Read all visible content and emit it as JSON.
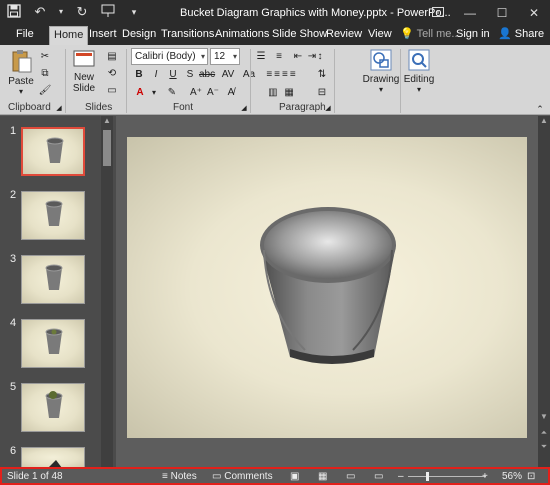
{
  "window": {
    "title": "Bucket Diagram Graphics with Money.pptx - PowerPo..."
  },
  "tabs": [
    {
      "label": "File"
    },
    {
      "label": "Home"
    },
    {
      "label": "Insert"
    },
    {
      "label": "Design"
    },
    {
      "label": "Transitions"
    },
    {
      "label": "Animations"
    },
    {
      "label": "Slide Show"
    },
    {
      "label": "Review"
    },
    {
      "label": "View"
    }
  ],
  "tell_me": "Tell me...",
  "sign_in": "Sign in",
  "share": "Share",
  "ribbon": {
    "paste_label": "Paste",
    "new_slide_label": "New Slide",
    "font_name": "Calibri (Body)",
    "font_size": "12",
    "drawing_label": "Drawing",
    "editing_label": "Editing",
    "groups": {
      "clipboard": "Clipboard",
      "slides": "Slides",
      "font": "Font",
      "paragraph": "Paragraph"
    }
  },
  "thumbnails": [
    {
      "num": "1"
    },
    {
      "num": "2"
    },
    {
      "num": "3"
    },
    {
      "num": "4"
    },
    {
      "num": "5"
    },
    {
      "num": "6"
    }
  ],
  "status": {
    "slide_counter": "Slide 1 of 48",
    "notes": "Notes",
    "comments": "Comments",
    "zoom": "56%"
  }
}
